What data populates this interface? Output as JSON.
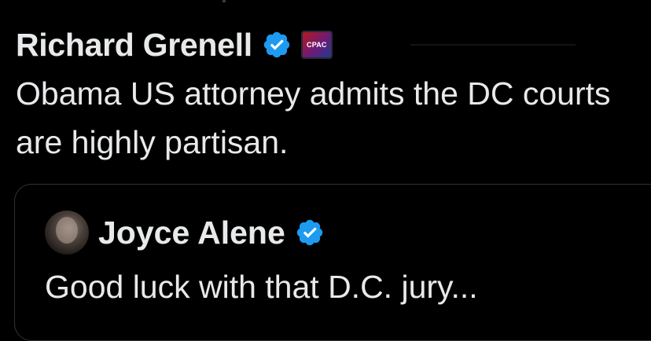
{
  "tweet": {
    "author_name": "Richard Grenell",
    "verified_icon": "verified-badge-icon",
    "affiliation_badge_text": "CPAC",
    "text": "Obama US attorney admits the DC courts are highly partisan."
  },
  "quoted_tweet": {
    "author_name": "Joyce Alene",
    "verified_icon": "verified-badge-icon",
    "text": "Good luck with that D.C. jury..."
  },
  "colors": {
    "background": "#000000",
    "text": "#e7e9ea",
    "verified_blue": "#1d9bf0",
    "card_border": "#2f3336"
  }
}
